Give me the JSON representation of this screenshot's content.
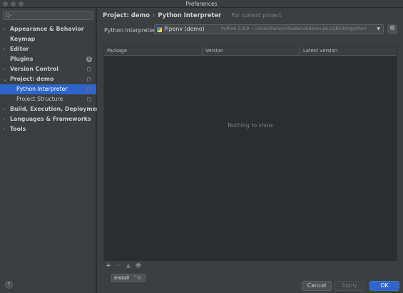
{
  "window": {
    "title": "Preferences"
  },
  "sidebar": {
    "search_placeholder": "Q-",
    "items": [
      {
        "label": "Appearance & Behavior",
        "chevron": "›"
      },
      {
        "label": "Keymap",
        "chevron": ""
      },
      {
        "label": "Editor",
        "chevron": "›"
      },
      {
        "label": "Plugins",
        "chevron": "",
        "badge": "2"
      },
      {
        "label": "Version Control",
        "chevron": "›"
      },
      {
        "label": "Project: demo",
        "chevron": "⌄"
      },
      {
        "label": "Python Interpreter",
        "chevron": ""
      },
      {
        "label": "Project Structure",
        "chevron": ""
      },
      {
        "label": "Build, Execution, Deployment",
        "chevron": "›"
      },
      {
        "label": "Languages & Frameworks",
        "chevron": "›"
      },
      {
        "label": "Tools",
        "chevron": "›"
      }
    ]
  },
  "main": {
    "breadcrumb": {
      "project": "Project: demo",
      "separator": "›",
      "page": "Python Interpreter",
      "scope": "For current project"
    },
    "interpreter": {
      "label": "Python Interpreter:",
      "name": "Pipenv (demo)",
      "path": "Python 3.9.9 ~/.local/share/virtualenvs/demo-jeLcvJRF/bin/python"
    },
    "table": {
      "columns": [
        "Package",
        "Version",
        "Latest version"
      ],
      "empty_text": "Nothing to show"
    },
    "toolbar": {
      "add": "+",
      "remove": "−",
      "upgrade": "▲",
      "eye": "👁"
    },
    "tooltip": {
      "text": "Install",
      "shortcut": "^N"
    }
  },
  "footer": {
    "help": "?",
    "cancel": "Cancel",
    "apply": "Apply",
    "ok": "OK"
  },
  "colors": {
    "accent": "#2f65ca",
    "ok_button": "#2e66cc",
    "background": "#3c3f41"
  }
}
